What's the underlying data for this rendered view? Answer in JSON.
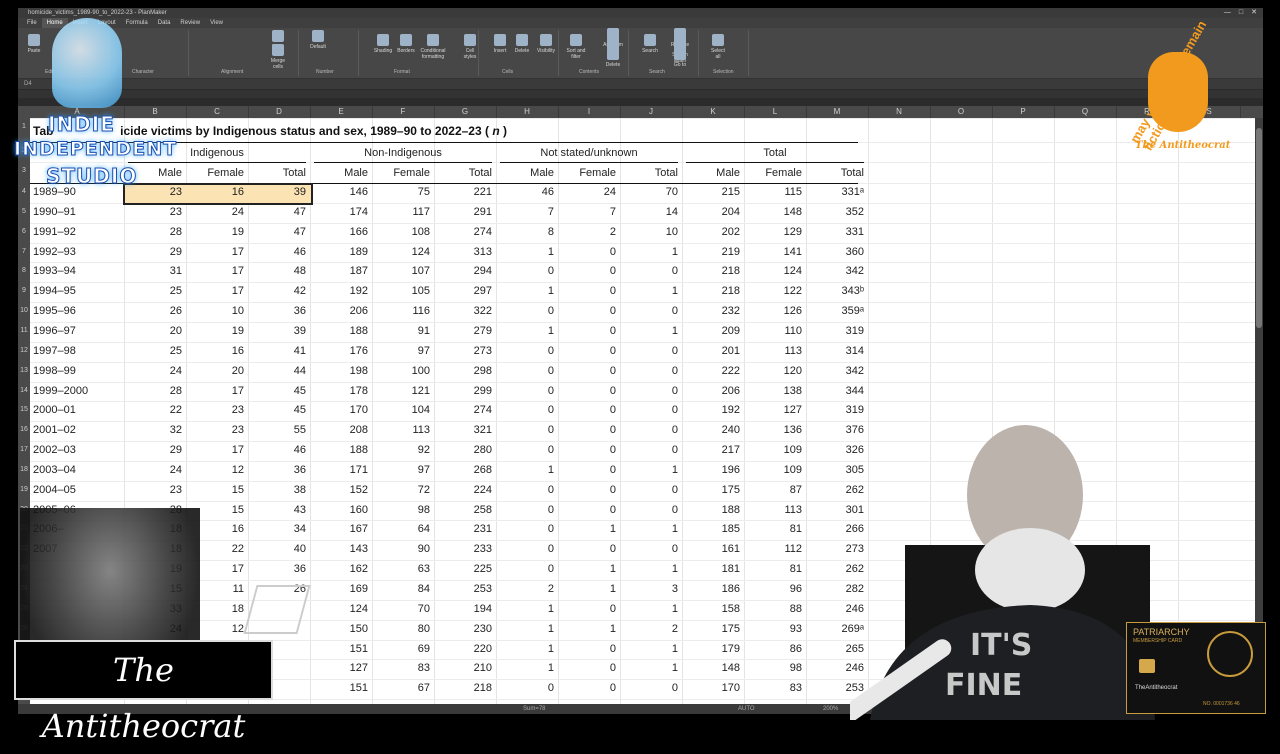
{
  "window": {
    "title": "homicide_victims_1989-90_to_2022-23 - PlanMaker",
    "menus": [
      "File",
      "Home",
      "Insert",
      "Layout",
      "Formula",
      "Data",
      "Review",
      "View"
    ],
    "active_menu": "Home"
  },
  "ribbon": {
    "groups": [
      "Edit",
      "Character",
      "Alignment",
      "Number",
      "Format",
      "Cells",
      "Contents",
      "Search",
      "Selection"
    ],
    "buttons": [
      "Paste",
      "Wrap text",
      "Merge cells",
      "Default",
      "Shading",
      "Borders",
      "Conditional formatting",
      "Cell styles",
      "Insert",
      "Delete",
      "Visibility",
      "Sort and filter",
      "Autosum",
      "Fill",
      "Delete",
      "Search",
      "Replace",
      "Search again",
      "Go to",
      "Select all"
    ]
  },
  "columns": [
    "A",
    "B",
    "C",
    "D",
    "E",
    "F",
    "G",
    "H",
    "I",
    "J",
    "K",
    "L",
    "M",
    "N",
    "O",
    "P",
    "Q",
    "R",
    "S"
  ],
  "rows": [
    1,
    2,
    3,
    4,
    5,
    6,
    7,
    8,
    9,
    10,
    11,
    12,
    13,
    14,
    15,
    16,
    17,
    18,
    19,
    20,
    21,
    22,
    23,
    24,
    25,
    26,
    27,
    28,
    29,
    30
  ],
  "table": {
    "title_prefix": "Tab",
    "title_rest": "icide victims by Indigenous status and sex, 1989–90 to 2022–23 (",
    "title_n": "n",
    "title_end": ")",
    "groups": [
      "Indigenous",
      "Non-Indigenous",
      "Not stated/unknown",
      "Total"
    ],
    "sub": [
      "Male",
      "Female",
      "Total"
    ],
    "data": [
      [
        "1989–90",
        "23",
        "16",
        "39",
        "146",
        "75",
        "221",
        "46",
        "24",
        "70",
        "215",
        "115",
        "331ᵃ"
      ],
      [
        "1990–91",
        "23",
        "24",
        "47",
        "174",
        "117",
        "291",
        "7",
        "7",
        "14",
        "204",
        "148",
        "352"
      ],
      [
        "1991–92",
        "28",
        "19",
        "47",
        "166",
        "108",
        "274",
        "8",
        "2",
        "10",
        "202",
        "129",
        "331"
      ],
      [
        "1992–93",
        "29",
        "17",
        "46",
        "189",
        "124",
        "313",
        "1",
        "0",
        "1",
        "219",
        "141",
        "360"
      ],
      [
        "1993–94",
        "31",
        "17",
        "48",
        "187",
        "107",
        "294",
        "0",
        "0",
        "0",
        "218",
        "124",
        "342"
      ],
      [
        "1994–95",
        "25",
        "17",
        "42",
        "192",
        "105",
        "297",
        "1",
        "0",
        "1",
        "218",
        "122",
        "343ᵇ"
      ],
      [
        "1995–96",
        "26",
        "10",
        "36",
        "206",
        "116",
        "322",
        "0",
        "0",
        "0",
        "232",
        "126",
        "359ᵃ"
      ],
      [
        "1996–97",
        "20",
        "19",
        "39",
        "188",
        "91",
        "279",
        "1",
        "0",
        "1",
        "209",
        "110",
        "319"
      ],
      [
        "1997–98",
        "25",
        "16",
        "41",
        "176",
        "97",
        "273",
        "0",
        "0",
        "0",
        "201",
        "113",
        "314"
      ],
      [
        "1998–99",
        "24",
        "20",
        "44",
        "198",
        "100",
        "298",
        "0",
        "0",
        "0",
        "222",
        "120",
        "342"
      ],
      [
        "1999–2000",
        "28",
        "17",
        "45",
        "178",
        "121",
        "299",
        "0",
        "0",
        "0",
        "206",
        "138",
        "344"
      ],
      [
        "2000–01",
        "22",
        "23",
        "45",
        "170",
        "104",
        "274",
        "0",
        "0",
        "0",
        "192",
        "127",
        "319"
      ],
      [
        "2001–02",
        "32",
        "23",
        "55",
        "208",
        "113",
        "321",
        "0",
        "0",
        "0",
        "240",
        "136",
        "376"
      ],
      [
        "2002–03",
        "29",
        "17",
        "46",
        "188",
        "92",
        "280",
        "0",
        "0",
        "0",
        "217",
        "109",
        "326"
      ],
      [
        "2003–04",
        "24",
        "12",
        "36",
        "171",
        "97",
        "268",
        "1",
        "0",
        "1",
        "196",
        "109",
        "305"
      ],
      [
        "2004–05",
        "23",
        "15",
        "38",
        "152",
        "72",
        "224",
        "0",
        "0",
        "0",
        "175",
        "87",
        "262"
      ],
      [
        "2005–06",
        "28",
        "15",
        "43",
        "160",
        "98",
        "258",
        "0",
        "0",
        "0",
        "188",
        "113",
        "301"
      ],
      [
        "2006–",
        "18",
        "16",
        "34",
        "167",
        "64",
        "231",
        "0",
        "1",
        "1",
        "185",
        "81",
        "266"
      ],
      [
        "2007",
        "18",
        "22",
        "40",
        "143",
        "90",
        "233",
        "0",
        "0",
        "0",
        "161",
        "112",
        "273"
      ],
      [
        "",
        "19",
        "17",
        "36",
        "162",
        "63",
        "225",
        "0",
        "1",
        "1",
        "181",
        "81",
        "262"
      ],
      [
        "",
        "15",
        "11",
        "26",
        "169",
        "84",
        "253",
        "2",
        "1",
        "3",
        "186",
        "96",
        "282"
      ],
      [
        "",
        "33",
        "18",
        "",
        "124",
        "70",
        "194",
        "1",
        "0",
        "1",
        "158",
        "88",
        "246"
      ],
      [
        "",
        "24",
        "12",
        "",
        "150",
        "80",
        "230",
        "1",
        "1",
        "2",
        "175",
        "93",
        "269ᵃ"
      ],
      [
        "",
        "",
        "",
        "",
        "151",
        "69",
        "220",
        "1",
        "0",
        "1",
        "179",
        "86",
        "265"
      ],
      [
        "",
        "",
        "",
        "",
        "127",
        "83",
        "210",
        "1",
        "0",
        "1",
        "148",
        "98",
        "246"
      ],
      [
        "",
        "",
        "",
        "",
        "151",
        "67",
        "218",
        "0",
        "0",
        "0",
        "170",
        "83",
        "253"
      ]
    ]
  },
  "overlays": {
    "studio_lines": [
      "INDIE",
      "INDEPENDENT",
      "STUDIO"
    ],
    "signature": "The Antitheocrat",
    "logo_text": "may your gods remain fictional",
    "logo_sub": "The Antitheocrat",
    "shirt_line1": "IT'S",
    "shirt_line2": "FINE",
    "card_title": "PATRIARCHY",
    "card_sub": "MEMBERSHIP CARD",
    "card_name": "TheAntitheocrat",
    "card_no": "NO. 0001736 46"
  },
  "status": {
    "sheet": "Sum=78",
    "mode": "AUTO",
    "zoom": "200%"
  }
}
